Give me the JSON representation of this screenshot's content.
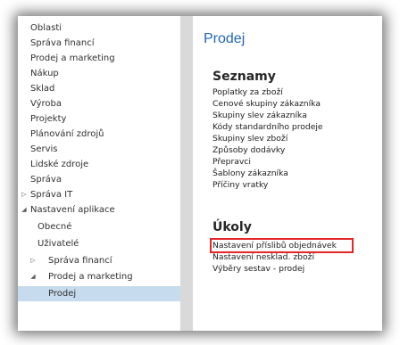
{
  "sidebar": {
    "items": [
      {
        "label": "Oblasti",
        "indent": 0,
        "caret": "",
        "selected": false
      },
      {
        "label": "Správa financí",
        "indent": 0,
        "caret": "",
        "selected": false
      },
      {
        "label": "Prodej a marketing",
        "indent": 0,
        "caret": "",
        "selected": false
      },
      {
        "label": "Nákup",
        "indent": 0,
        "caret": "",
        "selected": false
      },
      {
        "label": "Sklad",
        "indent": 0,
        "caret": "",
        "selected": false
      },
      {
        "label": "Výroba",
        "indent": 0,
        "caret": "",
        "selected": false
      },
      {
        "label": "Projekty",
        "indent": 0,
        "caret": "",
        "selected": false
      },
      {
        "label": "Plánování zdrojů",
        "indent": 0,
        "caret": "",
        "selected": false
      },
      {
        "label": "Servis",
        "indent": 0,
        "caret": "",
        "selected": false
      },
      {
        "label": "Lidské zdroje",
        "indent": 0,
        "caret": "",
        "selected": false
      },
      {
        "label": "Správa",
        "indent": 0,
        "caret": "",
        "selected": false
      },
      {
        "label": "Správa IT",
        "indent": 1,
        "caret": "▷",
        "selected": false
      },
      {
        "label": "Nastavení aplikace",
        "indent": 1,
        "caret": "◢",
        "selected": false
      },
      {
        "label": "Obecné",
        "indent": 2,
        "caret": "",
        "selected": false
      },
      {
        "label": "Uživatelé",
        "indent": 2,
        "caret": "",
        "selected": false
      },
      {
        "label": "Správa financí",
        "indent": 3,
        "caret": "▷",
        "selected": false
      },
      {
        "label": "Prodej a marketing",
        "indent": 3,
        "caret": "◢",
        "selected": false
      },
      {
        "label": "Prodej",
        "indent": 4,
        "caret": "",
        "selected": true
      }
    ]
  },
  "content": {
    "title": "Prodej",
    "sections": [
      {
        "title": "Seznamy",
        "links": [
          "Poplatky za zboží",
          "Cenové skupiny zákazníka",
          "Skupiny slev zákazníka",
          "Kódy standardního prodeje",
          "Skupiny slev zboží",
          "Způsoby dodávky",
          "Přepravci",
          "Šablony zákazníka",
          "Příčiny vratky"
        ]
      },
      {
        "title": "Úkoly",
        "links": [
          "Nastavení příslibů objednávek",
          "Nastavení nesklad. zboží",
          "Výběry sestav - prodej"
        ],
        "highlighted_index": 0
      }
    ]
  },
  "colors": {
    "title_blue": "#1f66b0",
    "selection": "#c7dbee",
    "highlight_box": "#e32626"
  }
}
